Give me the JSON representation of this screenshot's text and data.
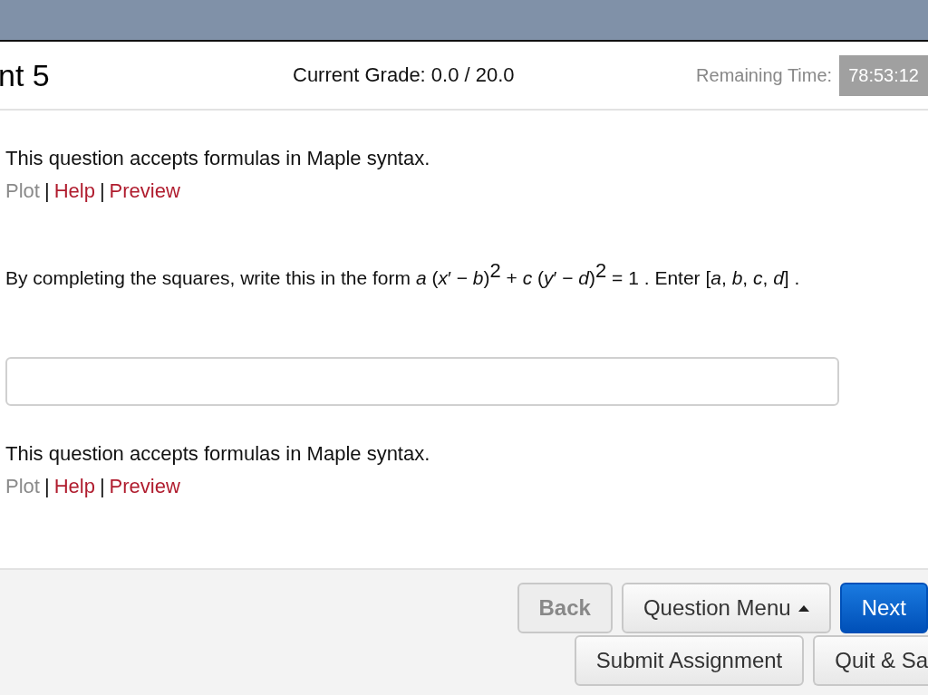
{
  "header": {
    "title": "nt 5",
    "grade": "Current Grade: 0.0 / 20.0",
    "time_label": "Remaining Time:",
    "time_value": "78:53:12"
  },
  "sections": [
    {
      "kind": "note",
      "text": "This question accepts formulas in Maple syntax.",
      "links": [
        {
          "kind": "link",
          "label": "Plot",
          "disabled": true
        },
        {
          "kind": "separator",
          "label": "|"
        },
        {
          "kind": "link",
          "label": "Help",
          "disabled": false
        },
        {
          "kind": "separator",
          "label": "|"
        },
        {
          "kind": "link",
          "label": "Preview",
          "disabled": false
        }
      ]
    },
    {
      "kind": "question",
      "text": "By completing the squares, write this in the form *a* (*x*′ − *b*)$^{2}$ + *c* (*y*′ − *d*)$^{2}$ = 1 . Enter [*a*, *b*, *c*, *d*] ."
    },
    {
      "kind": "answer"
    },
    {
      "kind": "note",
      "text": "This question accepts formulas in Maple syntax.",
      "links": [
        {
          "kind": "link",
          "label": "Plot",
          "disabled": true
        },
        {
          "kind": "separator",
          "label": "|"
        },
        {
          "kind": "link",
          "label": "Help",
          "disabled": false
        },
        {
          "kind": "separator",
          "label": "|"
        },
        {
          "kind": "link",
          "label": "Preview",
          "disabled": false
        }
      ]
    }
  ],
  "footer": {
    "buttons": [
      {
        "label": "Back",
        "kind": "plain",
        "disabled": true
      },
      {
        "label": "Question Menu",
        "kind": "menu",
        "disabled": false
      },
      {
        "label": "Next",
        "kind": "primary",
        "disabled": false
      },
      {
        "label": "Submit Assignment",
        "kind": "plain",
        "disabled": false
      },
      {
        "label": "Quit & Sa",
        "kind": "cut",
        "disabled": false
      }
    ]
  }
}
